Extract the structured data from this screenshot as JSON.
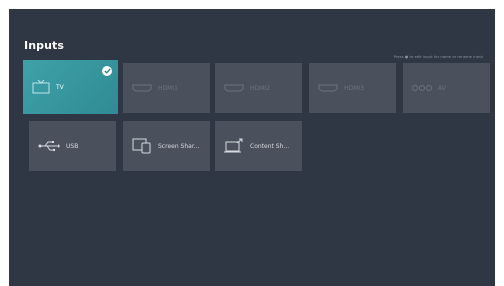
{
  "header": {
    "title": "Inputs",
    "hint": "Press ● to edit input for name or rename input"
  },
  "inputs_row1": [
    {
      "label": "TV",
      "icon": "tv-icon",
      "selected": true
    },
    {
      "label": "HDMI1",
      "icon": "hdmi-icon",
      "selected": false
    },
    {
      "label": "HDMI2",
      "icon": "hdmi-icon",
      "selected": false
    },
    {
      "label": "HDMI3",
      "icon": "hdmi-icon",
      "selected": false
    },
    {
      "label": "AV",
      "icon": "av-icon",
      "selected": false
    }
  ],
  "inputs_row2": [
    {
      "label": "USB",
      "icon": "usb-icon"
    },
    {
      "label": "Screen Shar...",
      "icon": "screen-share-icon"
    },
    {
      "label": "Content Sh...",
      "icon": "content-share-icon"
    }
  ],
  "colors": {
    "background": "#303744",
    "tile": "#4a515d",
    "selected": "#3fa1a8"
  }
}
